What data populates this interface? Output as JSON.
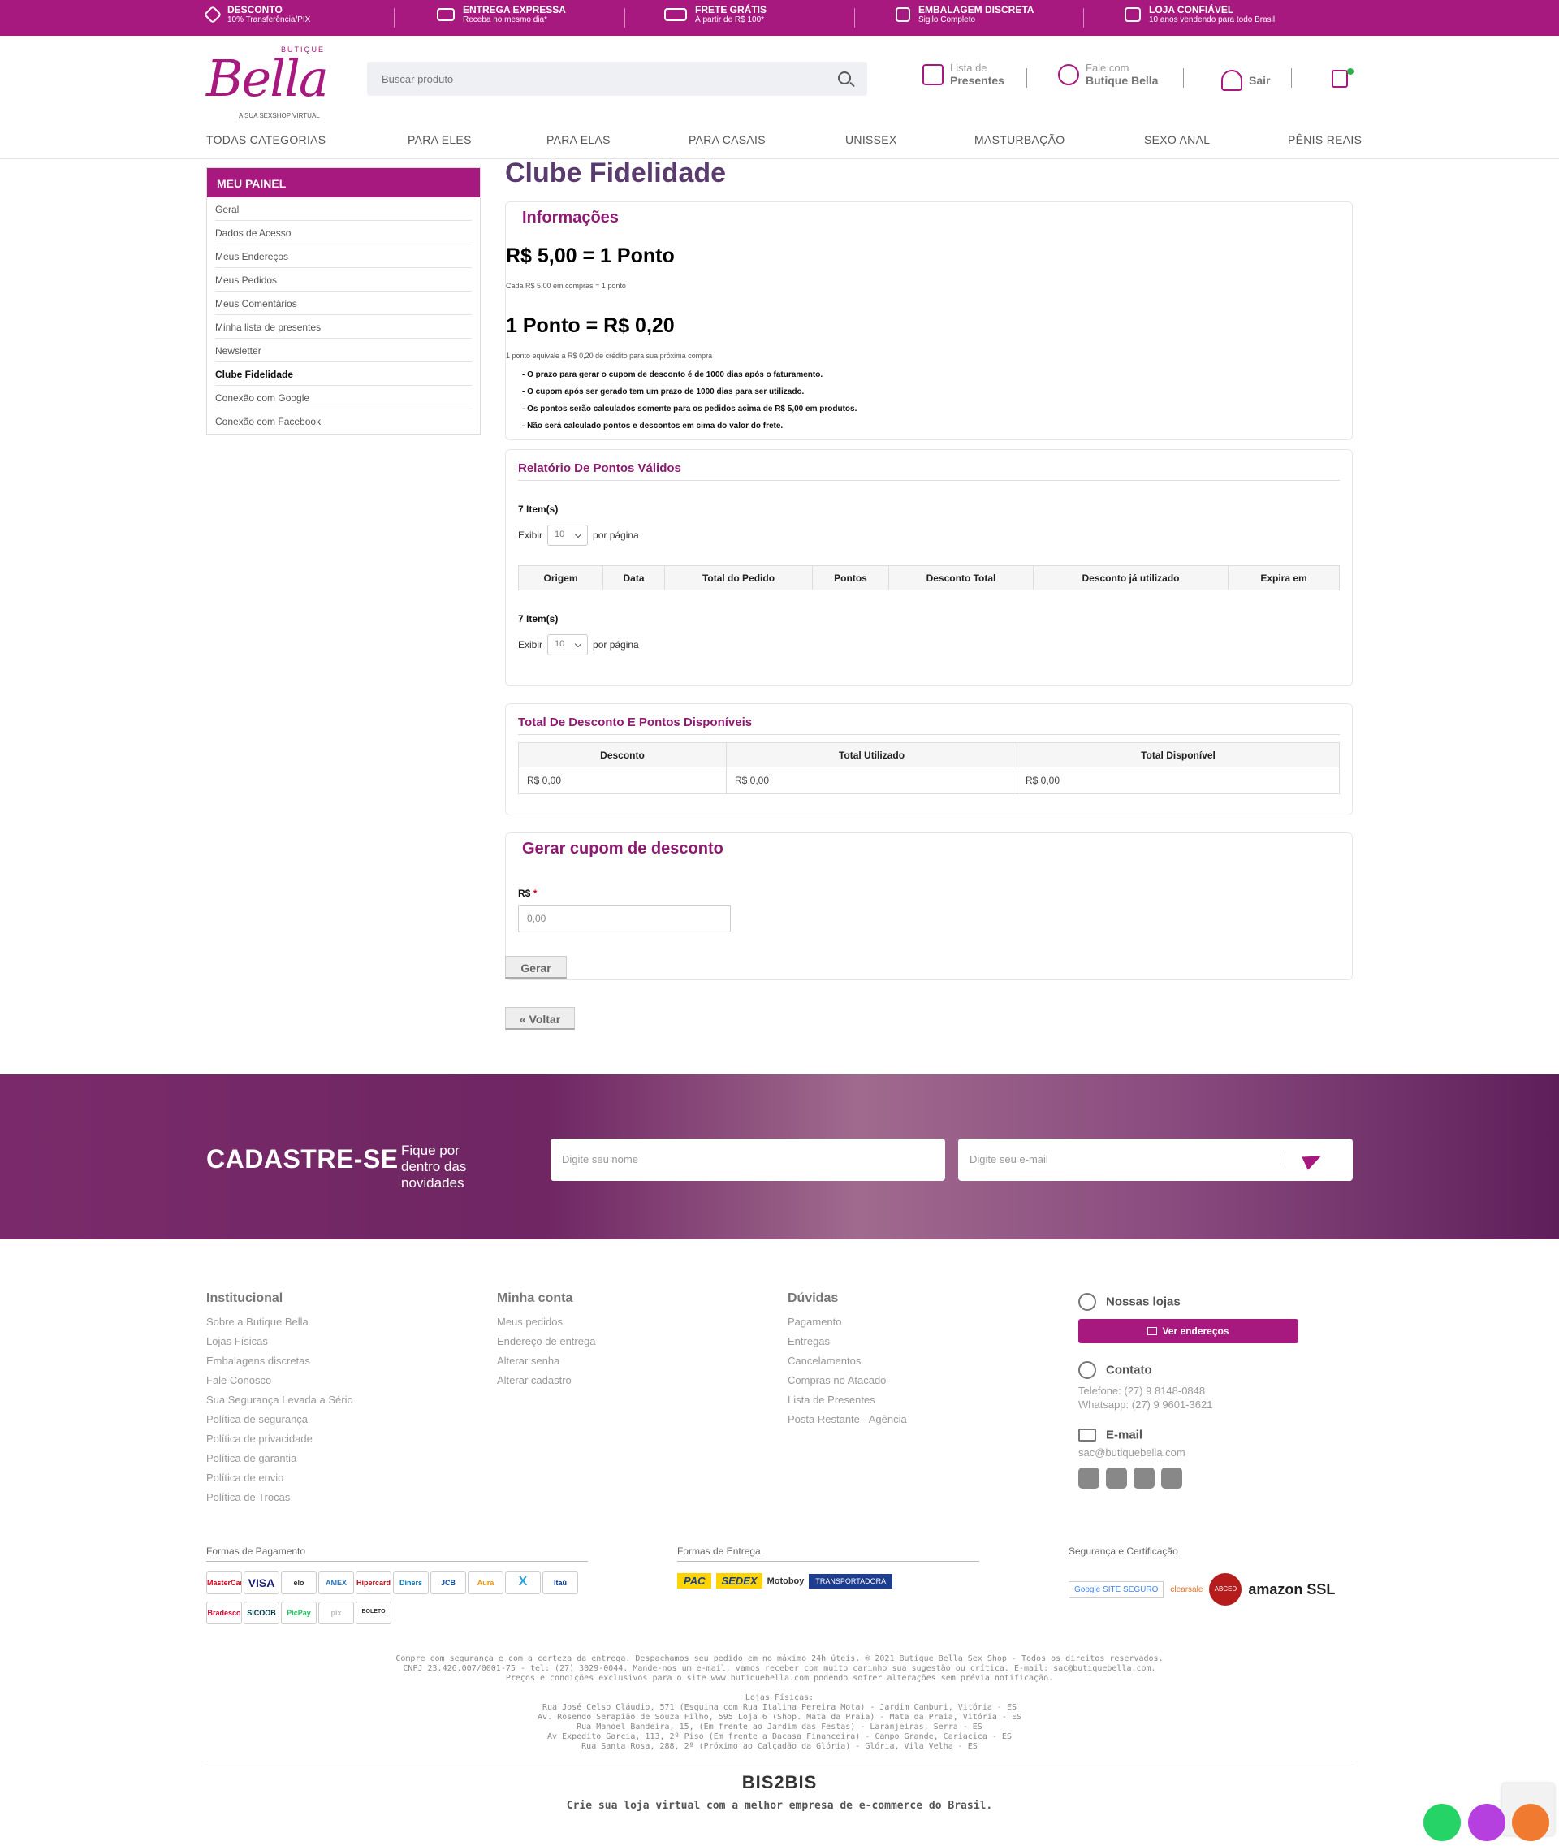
{
  "topbar": {
    "items": [
      {
        "title": "DESCONTO",
        "sub": "10% Transferência/PIX",
        "icon": "tag-icon"
      },
      {
        "title": "ENTREGA EXPRESSA",
        "sub": "Receba no mesmo dia*",
        "icon": "truck-fast-icon"
      },
      {
        "title": "FRETE GRÁTIS",
        "sub": "À partir de R$ 100*",
        "icon": "truck-icon"
      },
      {
        "title": "EMBALAGEM DISCRETA",
        "sub": "Sigilo Completo",
        "icon": "box-icon"
      },
      {
        "title": "LOJA CONFIÁVEL",
        "sub": "10 anos vendendo para todo Brasil",
        "icon": "store-icon"
      }
    ]
  },
  "header": {
    "logo_top": "BUTIQUE",
    "logo_main": "Bella",
    "logo_sub": "A SUA SEXSHOP VIRTUAL",
    "search_placeholder": "Buscar produto",
    "links": [
      {
        "a": "Lista de",
        "b": "Presentes"
      },
      {
        "a": "Fale com",
        "b": "Butique Bella"
      },
      {
        "a": "",
        "b": "Sair"
      }
    ]
  },
  "nav": [
    "TODAS CATEGORIAS",
    "PARA ELES",
    "PARA ELAS",
    "PARA CASAIS",
    "UNISSEX",
    "MASTURBAÇÃO",
    "SEXO ANAL",
    "PÊNIS REAIS"
  ],
  "panel": {
    "title": "MEU PAINEL",
    "items": [
      "Geral",
      "Dados de Acesso",
      "Meus Endereços",
      "Meus Pedidos",
      "Meus Comentários",
      "Minha lista de presentes",
      "Newsletter",
      "Clube Fidelidade",
      "Conexão com Google",
      "Conexão com Facebook"
    ]
  },
  "main": {
    "title": "Clube Fidelidade",
    "info": {
      "title": "Informações",
      "rate1": "R$ 5,00 = 1 Ponto",
      "rate1_sub": "Cada R$ 5,00 em compras = 1 ponto",
      "rate2": "1 Ponto = R$ 0,20",
      "rate2_sub": "1 ponto equivale a R$ 0,20 de crédito para sua próxima compra",
      "bullets": [
        "- O prazo para gerar o cupom de desconto é de 1000 dias após o faturamento.",
        "- O cupom após ser gerado tem um prazo de 1000 dias para ser utilizado.",
        "- Os pontos serão calculados somente para os pedidos acima de R$ 5,00 em produtos.",
        "- Não será calculado pontos e descontos em cima do valor do frete."
      ]
    },
    "report": {
      "title": "Relatório De Pontos Válidos",
      "items_count": "7 Item(s)",
      "show_label": "Exibir",
      "per_page_value": "10",
      "per_page_label": "por página",
      "columns": [
        "Origem",
        "Data",
        "Total do Pedido",
        "Pontos",
        "Desconto Total",
        "Desconto já utilizado",
        "Expira em"
      ]
    },
    "totals": {
      "title": "Total De Desconto E Pontos Disponíveis",
      "columns": [
        "Desconto",
        "Total Utilizado",
        "Total Disponível"
      ],
      "values": [
        "R$ 0,00",
        "R$ 0,00",
        "R$ 0,00"
      ]
    },
    "coupon": {
      "title": "Gerar cupom de desconto",
      "label": "R$",
      "required": "*",
      "placeholder": "0,00",
      "button": "Gerar"
    },
    "back_button": "« Voltar"
  },
  "newsletter": {
    "title": "CADASTRE-SE",
    "subtitle": "Fique por dentro das novidades",
    "name_placeholder": "Digite seu nome",
    "email_placeholder": "Digite seu e-mail"
  },
  "footer": {
    "institucional": {
      "title": "Institucional",
      "links": [
        "Sobre a Butique Bella",
        "Lojas Físicas",
        "Embalagens discretas",
        "Fale Conosco",
        "Sua Segurança Levada a Sério",
        "Política de segurança",
        "Política de privacidade",
        "Política de garantia",
        "Política de envio",
        "Política de Trocas"
      ]
    },
    "conta": {
      "title": "Minha conta",
      "links": [
        "Meus pedidos",
        "Endereço de entrega",
        "Alterar senha",
        "Alterar cadastro"
      ]
    },
    "duvidas": {
      "title": "Dúvidas",
      "links": [
        "Pagamento",
        "Entregas",
        "Cancelamentos",
        "Compras no Atacado",
        "Lista de Presentes",
        "Posta Restante - Agência"
      ]
    },
    "lojas_title": "Nossas lojas",
    "lojas_button": "Ver endereços",
    "contato_title": "Contato",
    "telefone": "Telefone: (27) 9 8148-0848",
    "whatsapp": "Whatsapp: (27) 9 9601-3621",
    "email_title": "E-mail",
    "email": "sac@butiquebella.com",
    "pagamento_title": "Formas de Pagamento",
    "entrega_title": "Formas de Entrega",
    "seguranca_title": "Segurança e Certificação",
    "payments": [
      "MasterCard",
      "VISA",
      "elo",
      "AMEX",
      "Hipercard",
      "Diners",
      "JCB",
      "Aura",
      "X",
      "Itaú",
      "Bradesco",
      "SICOOB",
      "PicPay",
      "pix",
      "BOLETO"
    ],
    "shipping": [
      "PAC",
      "SEDEX",
      "Motoboy",
      "TRANSPORTADORA"
    ],
    "security": [
      "Google SITE SEGURO",
      "clearsale",
      "ABCED",
      "amazon SSL"
    ],
    "legal": [
      "Compre com segurança e com a certeza da entrega. Despachamos seu pedido em no máximo 24h úteis. ® 2021 Butique Bella Sex Shop - Todos os direitos reservados.",
      "CNPJ 23.426.007/0001-75 - tel: (27) 3029-0044. Mande-nos um e-mail, vamos receber com muito carinho sua sugestão ou crítica. E-mail: sac@butiquebella.com.",
      "Preços e condições exclusivos para o site www.butiquebella.com podendo sofrer alterações sem prévia notificação.",
      "",
      "Lojas Físicas:",
      "Rua José Celso Cláudio, 571 (Esquina com Rua Italina Pereira Mota) - Jardim Camburi, Vitória - ES",
      "Av. Rosendo Serapião de Souza Filho, 595 Loja 6 (Shop. Mata da Praia) - Mata da Praia, Vitória - ES",
      "Rua Manoel Bandeira, 15, (Em frente ao Jardim das Festas) - Laranjeiras, Serra - ES",
      "Av Expedito Garcia, 113, 2º Piso (Em frente a Dacasa Financeira) - Campo Grande, Cariacica - ES",
      "Rua Santa Rosa, 288, 2º (Próximo ao Calçadão da Glória) - Glória, Vila Velha - ES"
    ],
    "bis2bis": "BIS2BIS",
    "bis2bis_tagline": "Crie sua loja virtual com a melhor empresa de e-commerce do Brasil."
  },
  "colors": {
    "brand": "#a8197f",
    "title": "#5a3b6e",
    "whatsapp": "#25d366",
    "phone": "#b63fe0",
    "email": "#f07a30"
  }
}
